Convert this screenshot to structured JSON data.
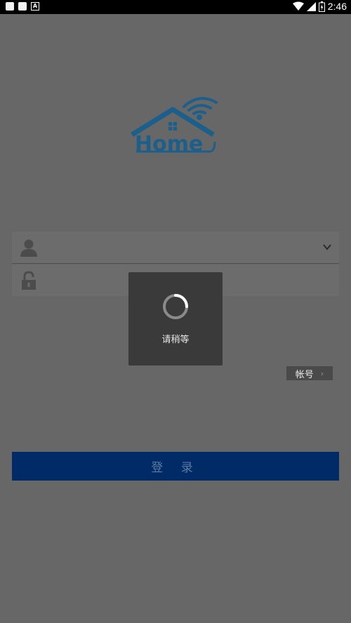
{
  "status_bar": {
    "time": "2:46"
  },
  "logo": {
    "text": "Home"
  },
  "login_form": {
    "username_value": "",
    "password_value": "",
    "account_button_label": "帐号",
    "account_button_arrow": "›",
    "login_button_label": "登 录"
  },
  "loading_dialog": {
    "message": "请稍等"
  },
  "colors": {
    "background": "#676767",
    "brand_blue": "#1c5f8a",
    "login_button": "#002b67"
  }
}
